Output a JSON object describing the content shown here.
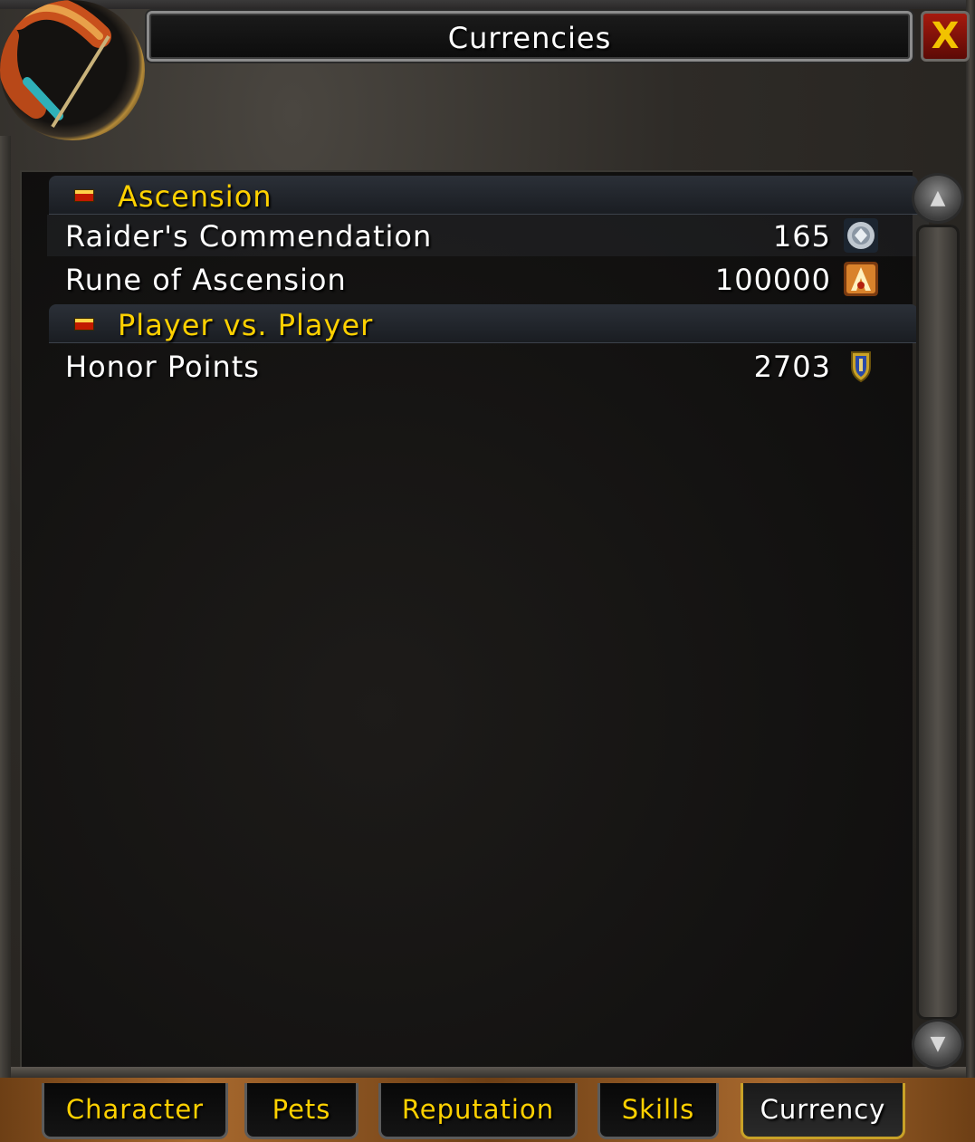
{
  "window": {
    "title": "Currencies",
    "close_label": "X"
  },
  "portrait": {
    "icon": "bow-icon"
  },
  "categories": [
    {
      "label": "Ascension",
      "items": [
        {
          "name": "Raider's Commendation",
          "count": "165",
          "icon": "commendation-icon"
        },
        {
          "name": "Rune of Ascension",
          "count": "100000",
          "icon": "rune-icon"
        }
      ]
    },
    {
      "label": "Player vs. Player",
      "items": [
        {
          "name": "Honor Points",
          "count": "2703",
          "icon": "honor-shield-icon"
        }
      ]
    }
  ],
  "scrollbar": {
    "up": "▲",
    "down": "▼"
  },
  "tabs": [
    {
      "label": "Character",
      "active": false
    },
    {
      "label": "Pets",
      "active": false
    },
    {
      "label": "Reputation",
      "active": false
    },
    {
      "label": "Skills",
      "active": false
    },
    {
      "label": "Currency",
      "active": true
    }
  ],
  "colors": {
    "header_text": "#ffd100",
    "item_text": "#ffffff",
    "tab_text": "#ffd100",
    "active_tab_border": "#c9a227",
    "close_button": "#a61a0e"
  }
}
